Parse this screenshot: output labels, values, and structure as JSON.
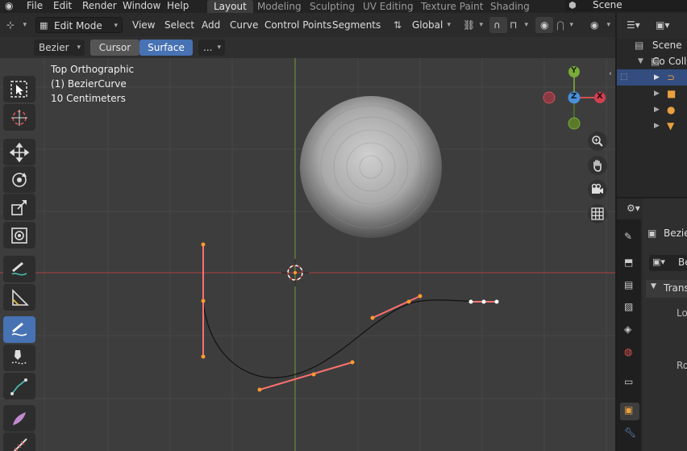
{
  "menu": {
    "file": "File",
    "edit": "Edit",
    "render": "Render",
    "window": "Window",
    "help": "Help"
  },
  "workspaces": [
    "Layout",
    "Modeling",
    "Sculpting",
    "UV Editing",
    "Texture Paint",
    "Shading"
  ],
  "active_workspace": "Layout",
  "scene_name": "Scene",
  "header": {
    "mode": "Edit Mode",
    "view": "View",
    "select": "Select",
    "add": "Add",
    "curve": "Curve",
    "control_points": "Control Points",
    "segments": "Segments",
    "orientation": "Global"
  },
  "tool_settings": {
    "curve_type": "Bezier",
    "cursor": "Cursor",
    "surface": "Surface",
    "more": "..."
  },
  "overlay": {
    "view_name": "Top Orthographic",
    "object_name": "(1) BezierCurve",
    "scale": "10 Centimeters"
  },
  "gizmo": {
    "y": "Y",
    "z": "Z",
    "x": "X"
  },
  "outliner": {
    "scene_collection": "Scene Co",
    "collection": "Colle"
  },
  "properties": {
    "object_name": "Bezie",
    "data_name": "Be",
    "section_transform": "Trans",
    "loc": "Lo",
    "rot": "Ro"
  },
  "colors": {
    "viewport_bg": "#3d3d3d",
    "x_axis": "#e06060",
    "y_axis": "#6a9a3a",
    "z_axis": "#4a90d8",
    "active_tool": "#4772b3",
    "handle": "#ff7070",
    "control_point": "#ff9a2e"
  }
}
